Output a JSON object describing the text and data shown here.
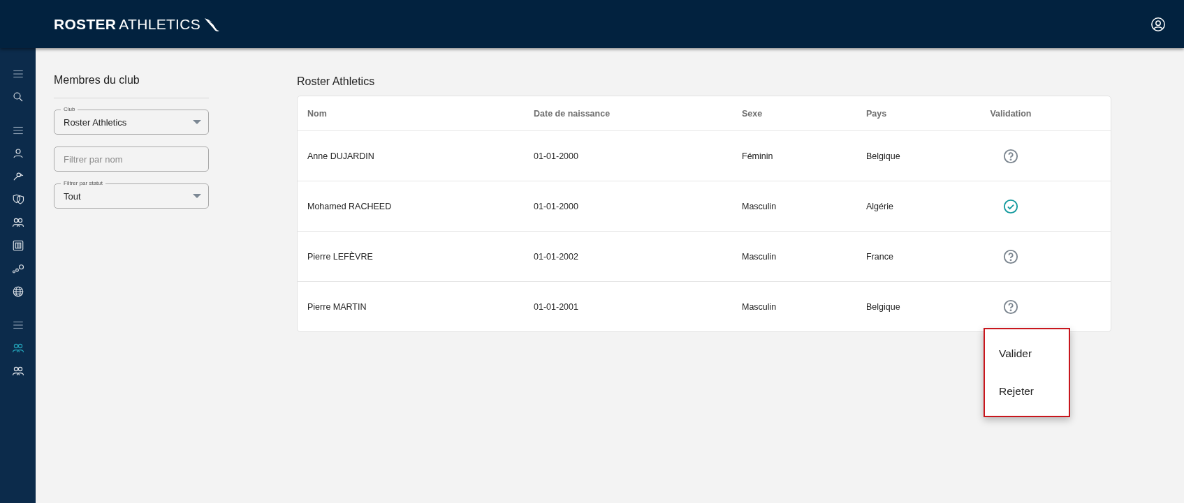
{
  "header": {
    "brand_bold": "ROSTER",
    "brand_light": "ATHLETICS"
  },
  "sidebar": {
    "sections": [
      {
        "items": [
          {
            "selected": false
          }
        ]
      },
      {
        "items": [
          {
            "selected": false
          },
          {
            "selected": false
          },
          {
            "selected": false
          },
          {
            "selected": false
          },
          {
            "selected": false
          },
          {
            "selected": false
          },
          {
            "selected": false
          }
        ]
      },
      {
        "items": [
          {
            "selected": true
          },
          {
            "selected": false
          }
        ]
      }
    ]
  },
  "filters": {
    "title": "Membres du club",
    "club": {
      "label": "Club",
      "value": "Roster Athletics"
    },
    "name_filter": {
      "placeholder": "Filtrer par nom"
    },
    "status_filter": {
      "label": "Filtrer par statut",
      "value": "Tout"
    }
  },
  "table": {
    "title": "Roster Athletics",
    "columns": [
      "Nom",
      "Date de naissance",
      "Sexe",
      "Pays",
      "Validation"
    ],
    "rows": [
      {
        "name": "Anne DUJARDIN",
        "birth_date": "01-01-2000",
        "sex": "Féminin",
        "country": "Belgique",
        "validated": false
      },
      {
        "name": "Mohamed RACHEED",
        "birth_date": "01-01-2000",
        "sex": "Masculin",
        "country": "Algérie",
        "validated": true
      },
      {
        "name": "Pierre LEFÈVRE",
        "birth_date": "01-01-2002",
        "sex": "Masculin",
        "country": "France",
        "validated": false
      },
      {
        "name": "Pierre MARTIN",
        "birth_date": "01-01-2001",
        "sex": "Masculin",
        "country": "Belgique",
        "validated": false
      }
    ]
  },
  "menu": {
    "items": [
      "Valider",
      "Rejeter"
    ]
  }
}
